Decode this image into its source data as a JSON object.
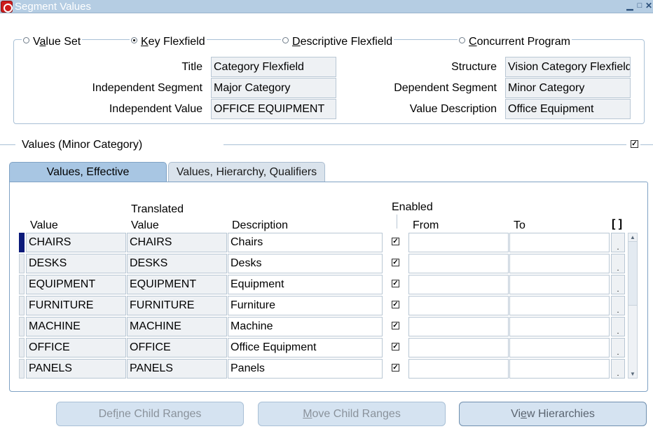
{
  "window": {
    "title": "Segment Values"
  },
  "radios": [
    {
      "accel": "",
      "accel_char": "a",
      "pre": "V",
      "post": "lue Set",
      "label": "Value Set",
      "checked": false
    },
    {
      "pre": "",
      "accel_char": "K",
      "post": "ey Flexfield",
      "label": "Key Flexfield",
      "checked": true
    },
    {
      "pre": "",
      "accel_char": "D",
      "post": "escriptive Flexfield",
      "label": "Descriptive Flexfield",
      "checked": false
    },
    {
      "pre": "",
      "accel_char": "C",
      "post": "oncurrent Program",
      "label": "Concurrent Program",
      "checked": false
    }
  ],
  "fields": {
    "title_label": "Title",
    "title_value": "Category Flexfield",
    "indep_segment_label": "Independent Segment",
    "indep_segment_value": "Major Category",
    "indep_value_label": "Independent Value",
    "indep_value_value": "OFFICE EQUIPMENT",
    "structure_label": "Structure",
    "structure_value": "Vision Category Flexfield",
    "dep_segment_label": "Dependent Segment",
    "dep_segment_value": "Minor Category",
    "value_desc_label": "Value Description",
    "value_desc_value": "Office Equipment"
  },
  "section": {
    "title": "Values (Minor Category)",
    "checked": true
  },
  "tabs": {
    "active": "Values, Effective",
    "inactive": "Values, Hierarchy, Qualifiers"
  },
  "table": {
    "headers": {
      "value": "Value",
      "translated_top": "Translated",
      "translated_bottom": "Value",
      "description": "Description",
      "enabled": "Enabled",
      "from": "From",
      "to": "To",
      "bracket": "[ ]"
    },
    "rows": [
      {
        "value": "CHAIRS",
        "translated": "CHAIRS",
        "description": "Chairs",
        "enabled": true,
        "from": "",
        "to": ""
      },
      {
        "value": "DESKS",
        "translated": "DESKS",
        "description": "Desks",
        "enabled": true,
        "from": "",
        "to": ""
      },
      {
        "value": "EQUIPMENT",
        "translated": "EQUIPMENT",
        "description": "Equipment",
        "enabled": true,
        "from": "",
        "to": ""
      },
      {
        "value": "FURNITURE",
        "translated": "FURNITURE",
        "description": "Furniture",
        "enabled": true,
        "from": "",
        "to": ""
      },
      {
        "value": "MACHINE",
        "translated": "MACHINE",
        "description": "Machine",
        "enabled": true,
        "from": "",
        "to": ""
      },
      {
        "value": "OFFICE",
        "translated": "OFFICE",
        "description": "Office Equipment",
        "enabled": true,
        "from": "",
        "to": ""
      },
      {
        "value": "PANELS",
        "translated": "PANELS",
        "description": "Panels",
        "enabled": true,
        "from": "",
        "to": ""
      }
    ],
    "minicell_text": "."
  },
  "buttons": {
    "define_pre": "Def",
    "define_accel": "i",
    "define_post": "ne Child Ranges",
    "move_pre": "",
    "move_accel": "M",
    "move_post": "ove Child Ranges",
    "view_pre": "Vi",
    "view_accel": "e",
    "view_post": "w Hierarchies"
  }
}
